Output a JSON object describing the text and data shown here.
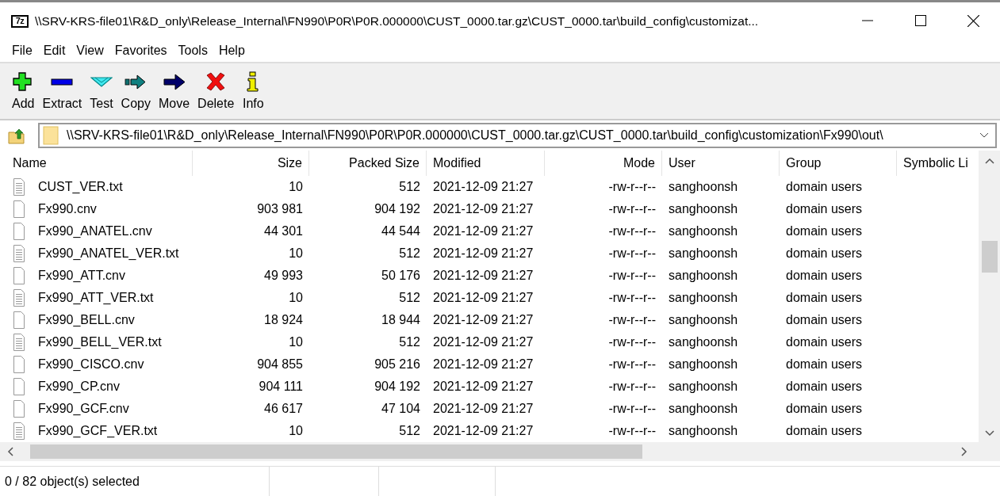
{
  "window": {
    "logo_text": "7z",
    "title": "\\\\SRV-KRS-file01\\R&D_only\\Release_Internal\\FN990\\P0R\\P0R.000000\\CUST_0000.tar.gz\\CUST_0000.tar\\build_config\\customizat..."
  },
  "menu": [
    "File",
    "Edit",
    "View",
    "Favorites",
    "Tools",
    "Help"
  ],
  "toolbar": [
    "Add",
    "Extract",
    "Test",
    "Copy",
    "Move",
    "Delete",
    "Info"
  ],
  "address": {
    "path": "\\\\SRV-KRS-file01\\R&D_only\\Release_Internal\\FN990\\P0R\\P0R.000000\\CUST_0000.tar.gz\\CUST_0000.tar\\build_config\\customization\\Fx990\\out\\"
  },
  "table": {
    "columns": [
      {
        "label": "Name"
      },
      {
        "label": "Size"
      },
      {
        "label": "Packed Size"
      },
      {
        "label": "Modified"
      },
      {
        "label": "Mode"
      },
      {
        "label": "User"
      },
      {
        "label": "Group"
      },
      {
        "label": "Symbolic Li"
      }
    ],
    "rows": [
      {
        "kind": "text",
        "cells": [
          "CUST_VER.txt",
          "10",
          "512",
          "2021-12-09 21:27",
          "-rw-r--r--",
          "sanghoonsh",
          "domain users"
        ]
      },
      {
        "kind": "file",
        "cells": [
          "Fx990.cnv",
          "903 981",
          "904 192",
          "2021-12-09 21:27",
          "-rw-r--r--",
          "sanghoonsh",
          "domain users"
        ]
      },
      {
        "kind": "file",
        "cells": [
          "Fx990_ANATEL.cnv",
          "44 301",
          "44 544",
          "2021-12-09 21:27",
          "-rw-r--r--",
          "sanghoonsh",
          "domain users"
        ]
      },
      {
        "kind": "text",
        "cells": [
          "Fx990_ANATEL_VER.txt",
          "10",
          "512",
          "2021-12-09 21:27",
          "-rw-r--r--",
          "sanghoonsh",
          "domain users"
        ]
      },
      {
        "kind": "file",
        "cells": [
          "Fx990_ATT.cnv",
          "49 993",
          "50 176",
          "2021-12-09 21:27",
          "-rw-r--r--",
          "sanghoonsh",
          "domain users"
        ]
      },
      {
        "kind": "text",
        "cells": [
          "Fx990_ATT_VER.txt",
          "10",
          "512",
          "2021-12-09 21:27",
          "-rw-r--r--",
          "sanghoonsh",
          "domain users"
        ]
      },
      {
        "kind": "file",
        "cells": [
          "Fx990_BELL.cnv",
          "18 924",
          "18 944",
          "2021-12-09 21:27",
          "-rw-r--r--",
          "sanghoonsh",
          "domain users"
        ]
      },
      {
        "kind": "text",
        "cells": [
          "Fx990_BELL_VER.txt",
          "10",
          "512",
          "2021-12-09 21:27",
          "-rw-r--r--",
          "sanghoonsh",
          "domain users"
        ]
      },
      {
        "kind": "file",
        "cells": [
          "Fx990_CISCO.cnv",
          "904 855",
          "905 216",
          "2021-12-09 21:27",
          "-rw-r--r--",
          "sanghoonsh",
          "domain users"
        ]
      },
      {
        "kind": "file",
        "cells": [
          "Fx990_CP.cnv",
          "904 111",
          "904 192",
          "2021-12-09 21:27",
          "-rw-r--r--",
          "sanghoonsh",
          "domain users"
        ]
      },
      {
        "kind": "file",
        "cells": [
          "Fx990_GCF.cnv",
          "46 617",
          "47 104",
          "2021-12-09 21:27",
          "-rw-r--r--",
          "sanghoonsh",
          "domain users"
        ]
      },
      {
        "kind": "text",
        "cells": [
          "Fx990_GCF_VER.txt",
          "10",
          "512",
          "2021-12-09 21:27",
          "-rw-r--r--",
          "sanghoonsh",
          "domain users"
        ]
      }
    ]
  },
  "status_bar": {
    "selection": "0 / 82 object(s) selected"
  }
}
